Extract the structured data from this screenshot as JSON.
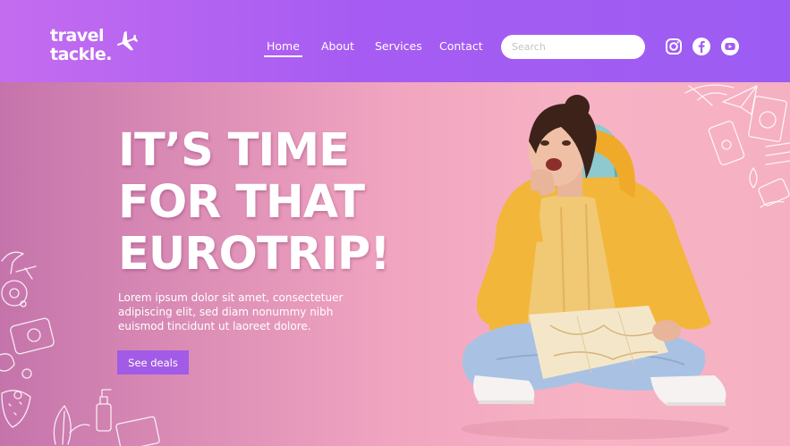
{
  "brand": {
    "line1": "travel",
    "line2": "tackle."
  },
  "nav": {
    "home": "Home",
    "about": "About",
    "services": "Services",
    "contact": "Contact"
  },
  "search": {
    "placeholder": "Search"
  },
  "social": [
    "instagram-icon",
    "facebook-icon",
    "youtube-icon"
  ],
  "hero": {
    "headline": [
      "IT’S TIME",
      "FOR THAT",
      "EUROTRIP!"
    ],
    "body": [
      "Lorem ipsum dolor sit amet, consectetuer",
      "adipiscing elit, sed diam nonummy nibh",
      "euismod tincidunt ut laoreet dolore."
    ],
    "cta": "See deals"
  },
  "colors": {
    "header_start": "#c46cf0",
    "header_end": "#9c5cf3",
    "cta": "#a25be6",
    "hero_pink": "#f6b3c3",
    "jacket": "#f2b63a",
    "jeans": "#a9c2e3"
  }
}
